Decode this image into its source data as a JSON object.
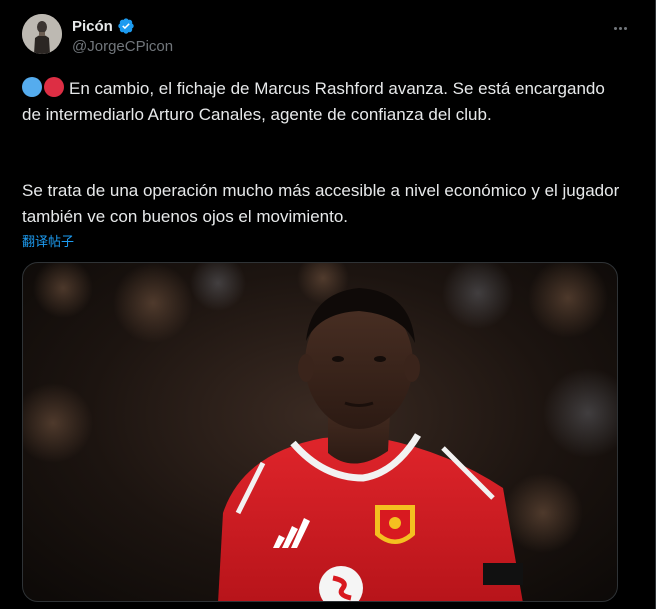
{
  "tweet": {
    "display_name": "Picón",
    "handle": "@JorgeCPicon",
    "paragraph1": "En cambio, el fichaje de Marcus Rashford avanza. Se está encargando de intermediarlo Arturo Canales, agente de confianza del club.",
    "paragraph2": "Se trata de una operación mucho más accesible a nivel económico y el jugador también ve con buenos ojos el movimiento.",
    "translate_label": "翻译帖子",
    "emoji": [
      "blue-circle",
      "red-circle"
    ]
  },
  "icons": {
    "verified": "verified-badge-icon",
    "more": "more-options-icon"
  },
  "colors": {
    "background": "#000000",
    "text": "#e7e9ea",
    "secondary": "#71767b",
    "link": "#1d9bf0",
    "verified": "#1d9bf0",
    "kit_red": "#d81920"
  }
}
